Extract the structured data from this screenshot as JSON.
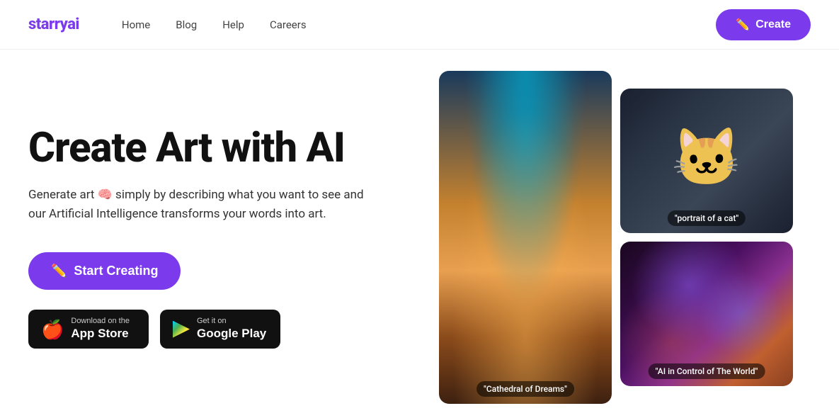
{
  "header": {
    "logo_text": "starry",
    "logo_highlight": "ai",
    "nav": [
      {
        "label": "Home",
        "id": "home"
      },
      {
        "label": "Blog",
        "id": "blog"
      },
      {
        "label": "Help",
        "id": "help"
      },
      {
        "label": "Careers",
        "id": "careers"
      }
    ],
    "create_button_label": "Create",
    "create_pencil": "✏️"
  },
  "hero": {
    "title": "Create Art with AI",
    "description": "Generate art 🧠 simply by describing what you want to see and our Artificial Intelligence transforms your words into art.",
    "start_button": "Start Creating",
    "start_icon": "✏️"
  },
  "app_store": {
    "sub_label": "Download on the",
    "name": "App Store",
    "icon": "🍎"
  },
  "google_play": {
    "sub_label": "Get it on",
    "name": "Google Play"
  },
  "gallery": {
    "image1_label": "\"Cathedral of Dreams\"",
    "image2_label": "\"portrait of a cat\"",
    "image3_label": "\"AI in Control of The World\""
  }
}
